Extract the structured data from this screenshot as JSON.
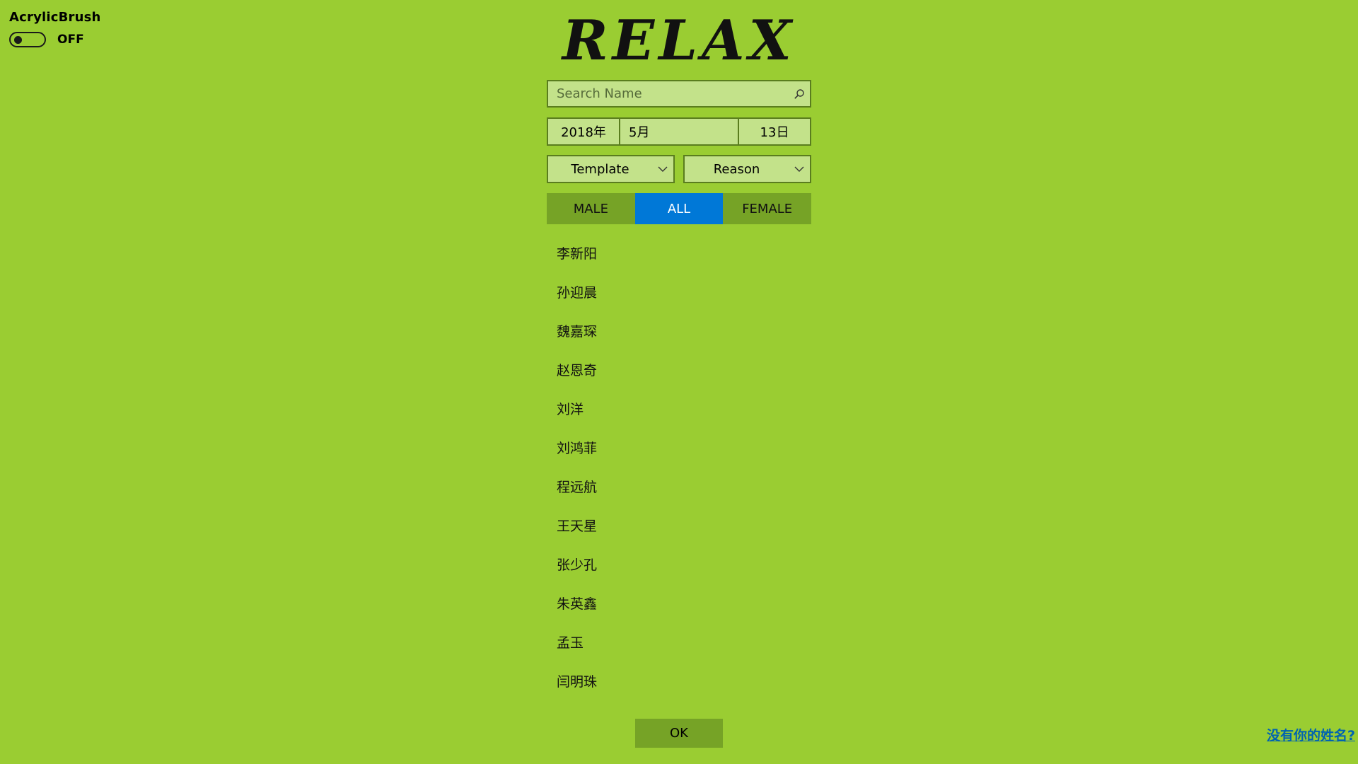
{
  "acrylic": {
    "title": "AcrylicBrush",
    "state": "OFF"
  },
  "title": "RELAX",
  "search": {
    "placeholder": "Search Name",
    "value": ""
  },
  "date": {
    "year": "2018年",
    "month": "5月",
    "day": "13日"
  },
  "dropdowns": {
    "template": "Template",
    "reason": "Reason"
  },
  "gender": {
    "options": [
      "MALE",
      "ALL",
      "FEMALE"
    ],
    "selected": "ALL"
  },
  "names": [
    "李新阳",
    "孙迎晨",
    "魏嘉琛",
    "赵恩奇",
    "刘洋",
    "刘鸿菲",
    "程远航",
    "王天星",
    "张少孔",
    "朱英鑫",
    "孟玉",
    "闫明珠"
  ],
  "ok_label": "OK",
  "missing_name_link": "没有你的姓名?",
  "colors": {
    "background": "#9acd32",
    "field": "#c3e28a",
    "button": "#76a326",
    "accent": "#0078d7",
    "link": "#0063b1"
  },
  "icons": {
    "search": "search-icon",
    "chevron": "chevron-down-icon"
  }
}
